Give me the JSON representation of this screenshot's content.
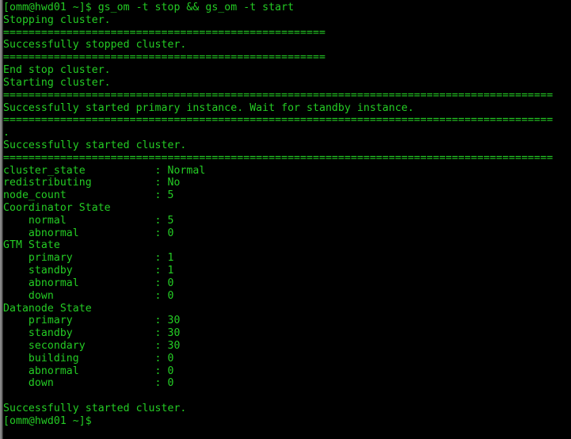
{
  "terminal": {
    "title": "omm@hwd01 terminal",
    "prompt": "[omm@hwd01 ~]$",
    "foreground_color": "#24cc24",
    "background_color": "#000000",
    "border_color": "#8a8a8a",
    "columns": 88,
    "rows": 35
  },
  "command": {
    "prompt": "[omm@hwd01 ~]$",
    "text": " gs_om -t stop && gs_om -t start",
    "full_line": "[omm@hwd01 ~]$ gs_om -t stop && gs_om -t start"
  },
  "separators": {
    "short": "===================================================",
    "long": "======================================================================================="
  },
  "output": {
    "stopping_cluster": "Stopping cluster.",
    "successfully_stopped": "Successfully stopped cluster.",
    "end_stop": "End stop cluster.",
    "starting_cluster": "Starting cluster.",
    "primary_started": "Successfully started primary instance. Wait for standby instance.",
    "progress_dot": ".",
    "successfully_started": "Successfully started cluster.",
    "final_started": "Successfully started cluster."
  },
  "cluster_status": {
    "fields": [
      {
        "label": "cluster_state",
        "value": "Normal"
      },
      {
        "label": "redistributing",
        "value": "No"
      },
      {
        "label": "node_count",
        "value": "5"
      }
    ],
    "coordinator_state": {
      "heading": "Coordinator State",
      "items": [
        {
          "label": "normal",
          "value": "5"
        },
        {
          "label": "abnormal",
          "value": "0"
        }
      ]
    },
    "gtm_state": {
      "heading": "GTM State",
      "items": [
        {
          "label": "primary",
          "value": "1"
        },
        {
          "label": "standby",
          "value": "1"
        },
        {
          "label": "abnormal",
          "value": "0"
        },
        {
          "label": "down",
          "value": "0"
        }
      ]
    },
    "datanode_state": {
      "heading": "Datanode State",
      "items": [
        {
          "label": "primary",
          "value": "30"
        },
        {
          "label": "standby",
          "value": "30"
        },
        {
          "label": "secondary",
          "value": "30"
        },
        {
          "label": "building",
          "value": "0"
        },
        {
          "label": "abnormal",
          "value": "0"
        },
        {
          "label": "down",
          "value": "0"
        }
      ]
    }
  },
  "final_prompt": "[omm@hwd01 ~]$"
}
